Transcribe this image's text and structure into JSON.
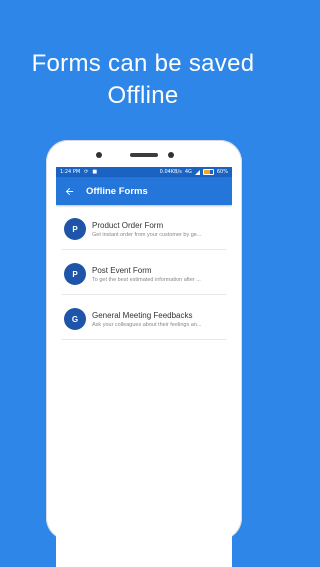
{
  "headline": {
    "line1": "Forms can be saved",
    "line2": "Offline"
  },
  "status_bar": {
    "time": "1:24 PM",
    "left_icons": [
      "sync-icon",
      "message-icon"
    ],
    "speed": "0.04KB/s",
    "network": "4G",
    "battery": "60%",
    "battery_level": 0.6
  },
  "app_bar": {
    "title": "Offline Forms",
    "back_icon": "arrow-back-icon"
  },
  "forms": [
    {
      "letter": "P",
      "title": "Product Order Form",
      "subtitle": "Get instant order from your customer by ge..."
    },
    {
      "letter": "P",
      "title": "Post Event Form",
      "subtitle": "To get the best estimated information after ..."
    },
    {
      "letter": "G",
      "title": "General Meeting Feedbacks",
      "subtitle": "Ask your colleagues about their feelings an..."
    }
  ],
  "colors": {
    "background": "#2e86e8",
    "appbar": "#2576da",
    "statusbar": "#1a63c2",
    "avatar": "#1e55a8"
  }
}
